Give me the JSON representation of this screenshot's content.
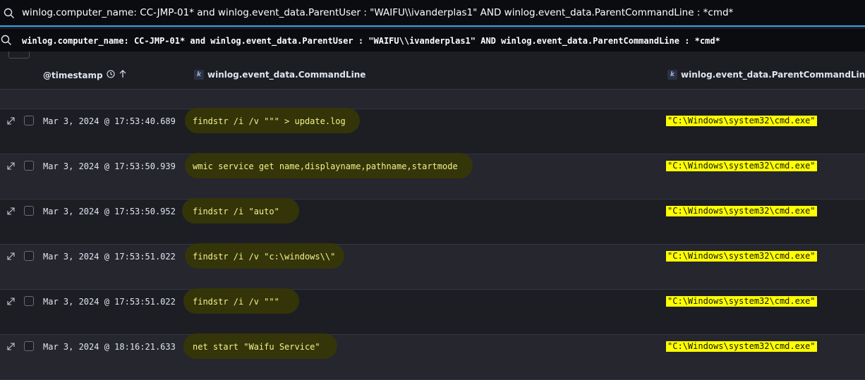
{
  "query": {
    "top_text": "winlog.computer_name: CC-JMP-01* and winlog.event_data.ParentUser : \"WAIFU\\\\ivanderplas1\"  AND  winlog.event_data.ParentCommandLine : *cmd*",
    "mono_text": "winlog.computer_name: CC-JMP-01* and winlog.event_data.ParentUser : \"WAIFU\\\\ivanderplas1\" AND winlog.event_data.ParentCommandLine : *cmd*",
    "icon": "search-icon"
  },
  "columns": {
    "timestamp": "@timestamp",
    "command_line": "winlog.event_data.CommandLine",
    "parent_command_line": "winlog.event_data.ParentCommandLine",
    "field_type_badge": "k"
  },
  "rows": [
    {
      "timestamp": "Mar 3, 2024 @ 17:53:40.689",
      "command_line": "findstr  /i /v \"\"\" > update.log",
      "parent_command_line": "\"C:\\Windows\\system32\\cmd.exe\""
    },
    {
      "timestamp": "Mar 3, 2024 @ 17:53:50.939",
      "command_line": "wmic  service get name,displayname,pathname,startmode",
      "parent_command_line": "\"C:\\Windows\\system32\\cmd.exe\""
    },
    {
      "timestamp": "Mar 3, 2024 @ 17:53:50.952",
      "command_line": "findstr  /i \"auto\"",
      "parent_command_line": "\"C:\\Windows\\system32\\cmd.exe\""
    },
    {
      "timestamp": "Mar 3, 2024 @ 17:53:51.022",
      "command_line": "findstr  /i /v \"c:\\windows\\\\\"",
      "parent_command_line": "\"C:\\Windows\\system32\\cmd.exe\""
    },
    {
      "timestamp": "Mar 3, 2024 @ 17:53:51.022",
      "command_line": "findstr  /i /v \"\"\"",
      "parent_command_line": "\"C:\\Windows\\system32\\cmd.exe\""
    },
    {
      "timestamp": "Mar 3, 2024 @ 18:16:21.633",
      "command_line": "net  start \"Waifu Service\"",
      "parent_command_line": "\"C:\\Windows\\system32\\cmd.exe\""
    }
  ],
  "colors": {
    "accent": "#36a2ef",
    "highlight": "#ffff00",
    "command_text": "#f2f28a"
  }
}
